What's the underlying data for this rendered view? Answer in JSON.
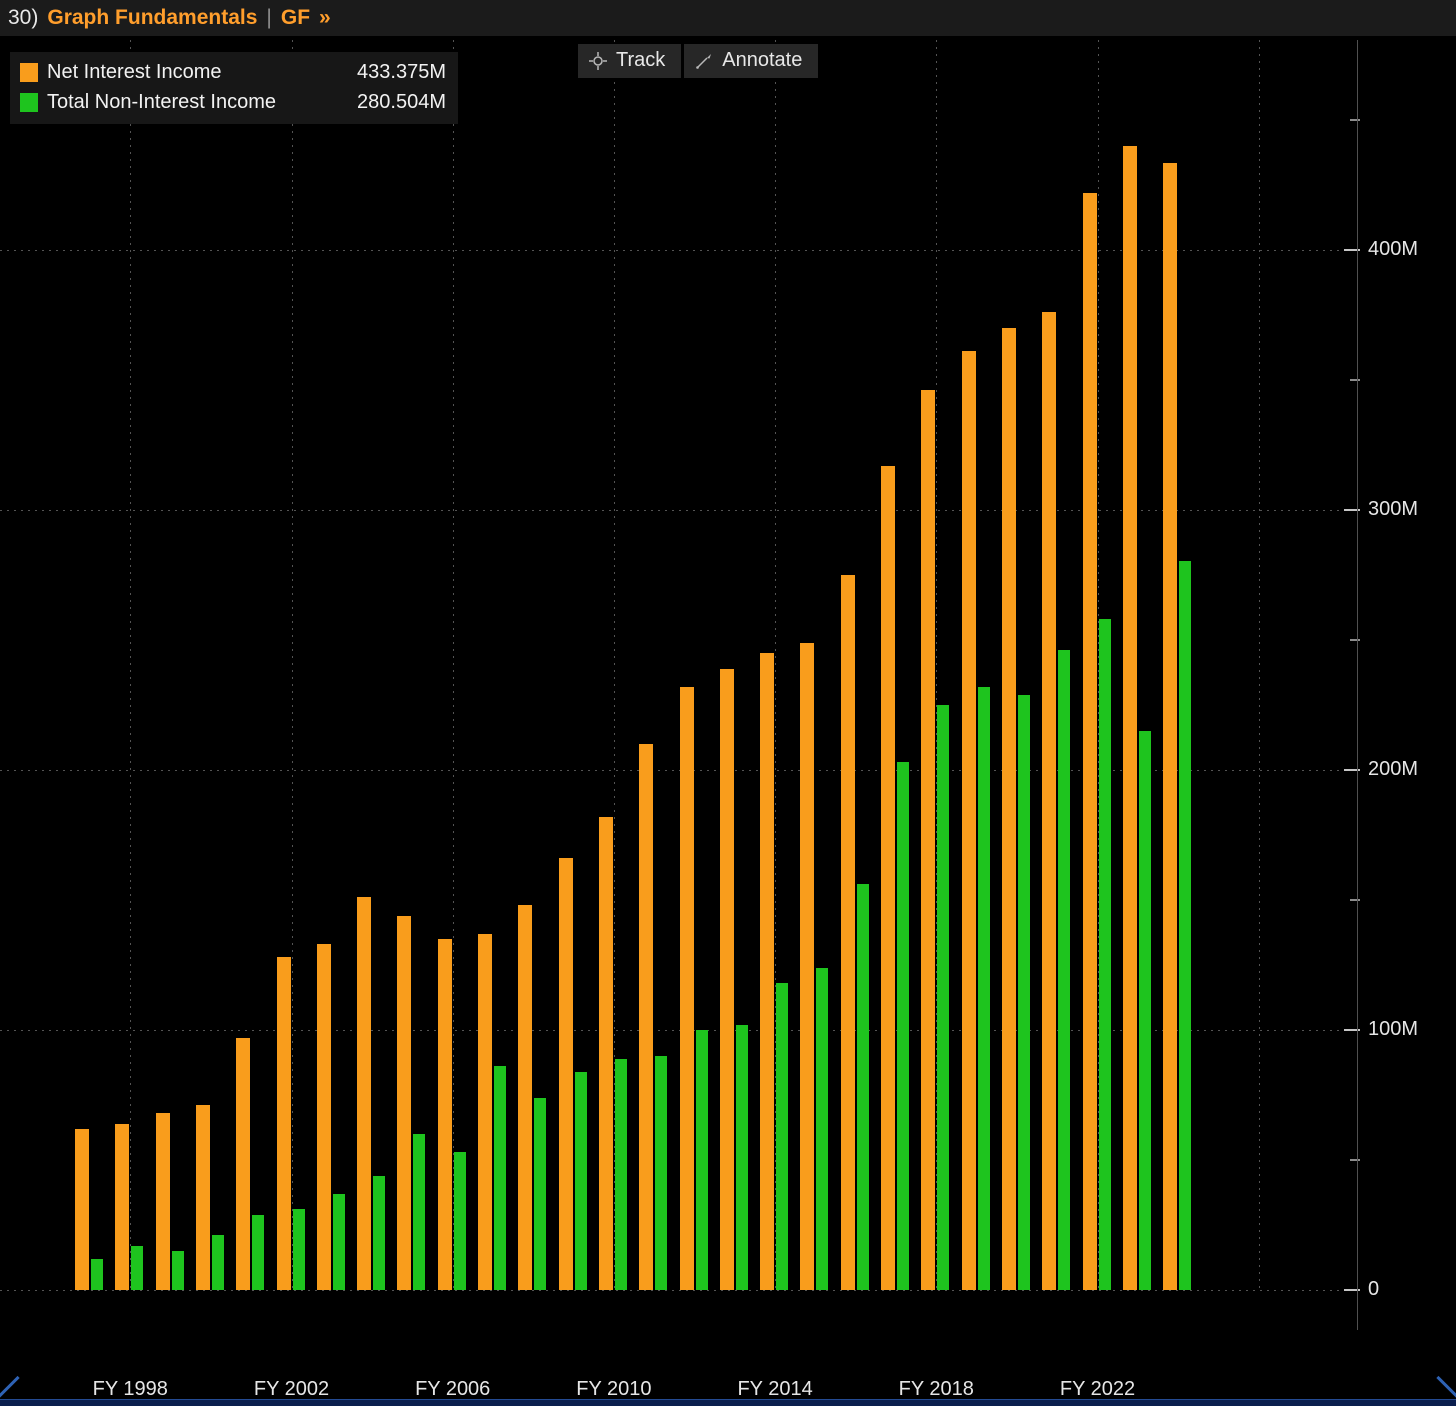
{
  "header": {
    "prefix": "30)",
    "title": "Graph Fundamentals",
    "separator": "|",
    "code": "GF",
    "chevrons": "»"
  },
  "toolbar": {
    "track_label": "Track",
    "annotate_label": "Annotate"
  },
  "legend": [
    {
      "label": "Net Interest Income",
      "value": "433.375M",
      "color": "#f99d1c"
    },
    {
      "label": "Total Non-Interest Income",
      "value": "280.504M",
      "color": "#1ec41e"
    }
  ],
  "colors": {
    "background": "#000000",
    "orange_series": "#f99d1c",
    "green_series": "#1ec41e",
    "titlebar_text": "#ff9e2c",
    "gridline": "#545454",
    "axis_text": "#e6e6e6"
  },
  "chart_data": {
    "type": "bar",
    "title": "",
    "xlabel": "",
    "ylabel": "",
    "unit": "M",
    "grid": true,
    "legend_position": "top-left",
    "ylim": [
      0,
      450
    ],
    "x": [
      "FY 1997",
      "FY 1998",
      "FY 1999",
      "FY 2000",
      "FY 2001",
      "FY 2002",
      "FY 2003",
      "FY 2004",
      "FY 2005",
      "FY 2006",
      "FY 2007",
      "FY 2008",
      "FY 2009",
      "FY 2010",
      "FY 2011",
      "FY 2012",
      "FY 2013",
      "FY 2014",
      "FY 2015",
      "FY 2016",
      "FY 2017",
      "FY 2018",
      "FY 2019",
      "FY 2020",
      "FY 2021",
      "FY 2022",
      "FY 2023",
      "FY 2024"
    ],
    "series": [
      {
        "name": "Net Interest Income",
        "color": "#f99d1c",
        "values": [
          62,
          64,
          68,
          71,
          97,
          128,
          133,
          151,
          144,
          135,
          137,
          148,
          166,
          182,
          210,
          232,
          239,
          245,
          249,
          275,
          317,
          346,
          361,
          370,
          376,
          422,
          440,
          433.375
        ]
      },
      {
        "name": "Total Non-Interest Income",
        "color": "#1ec41e",
        "values": [
          12,
          17,
          15,
          21,
          29,
          31,
          37,
          44,
          60,
          53,
          86,
          74,
          84,
          89,
          90,
          100,
          102,
          118,
          124,
          156,
          203,
          225,
          232,
          229,
          246,
          258,
          215,
          280.504
        ]
      }
    ],
    "y_ticks": [
      {
        "value": 0,
        "label": "0"
      },
      {
        "value": 100,
        "label": "100M"
      },
      {
        "value": 200,
        "label": "200M"
      },
      {
        "value": 300,
        "label": "300M"
      },
      {
        "value": 400,
        "label": "400M"
      }
    ],
    "y_minor_ticks": [
      50,
      150,
      250,
      350,
      450
    ],
    "x_axis_labels": [
      "FY 1998",
      "FY 2002",
      "FY 2006",
      "FY 2010",
      "FY 2014",
      "FY 2018",
      "FY 2022"
    ]
  }
}
